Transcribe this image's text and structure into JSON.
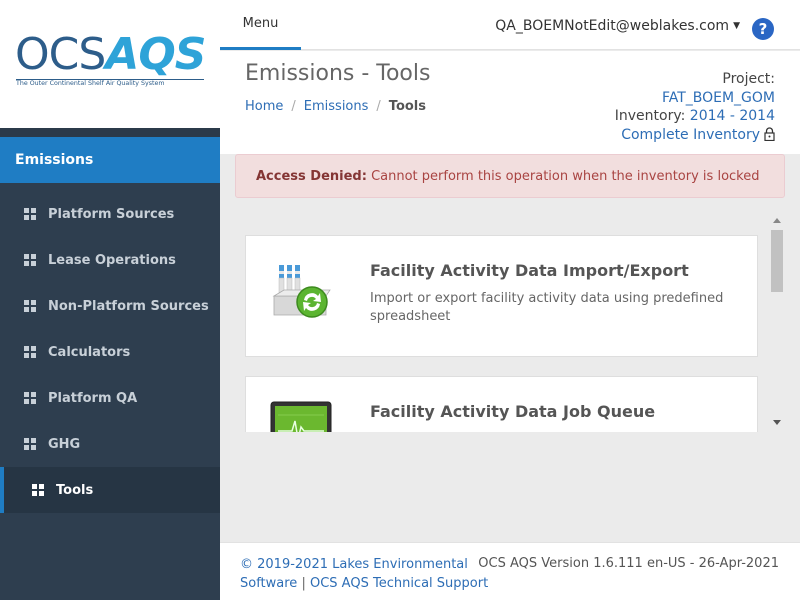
{
  "logo": {
    "ocs": "OCS",
    "aqs": "AQS",
    "tagline": "The Outer Continental Shelf Air Quality System"
  },
  "sidebar": {
    "section": "Emissions",
    "items": [
      {
        "label": "Platform Sources"
      },
      {
        "label": "Lease Operations"
      },
      {
        "label": "Non-Platform Sources"
      },
      {
        "label": "Calculators"
      },
      {
        "label": "Platform QA"
      },
      {
        "label": "GHG"
      },
      {
        "label": "Tools",
        "active": true
      }
    ]
  },
  "topbar": {
    "menu_label": "Menu",
    "user": "QA_BOEMNotEdit@weblakes.com",
    "caret": "▼",
    "help": "?"
  },
  "header": {
    "title": "Emissions - Tools",
    "breadcrumb": {
      "home": "Home",
      "sep": "/",
      "emissions": "Emissions",
      "current": "Tools"
    },
    "project_label": "Project:",
    "project": "FAT_BOEM_GOM",
    "inventory_label": "Inventory:",
    "inventory": "2014 - 2014",
    "complete_inventory": "Complete Inventory"
  },
  "alert": {
    "title": "Access Denied:",
    "message": "Cannot perform this operation when the inventory is locked"
  },
  "tools": [
    {
      "title": "Facility Activity Data Import/Export",
      "description": "Import or export facility activity data using predefined spreadsheet",
      "icon": "factory-sync-icon"
    },
    {
      "title": "Facility Activity Data Job Queue",
      "description": "",
      "icon": "monitor-chart-icon"
    }
  ],
  "footer": {
    "copyright": "© 2019-2021 Lakes Environmental Software",
    "pipe": "|",
    "support": "OCS AQS Technical Support",
    "version": "OCS AQS Version 1.6.111 en-US - 26-Apr-2021"
  },
  "colors": {
    "sidebar": "#2e3e4f",
    "accent": "#1f7dc4",
    "link": "#2d6db5",
    "alert_bg": "#f2dede",
    "alert_text": "#a94442"
  }
}
